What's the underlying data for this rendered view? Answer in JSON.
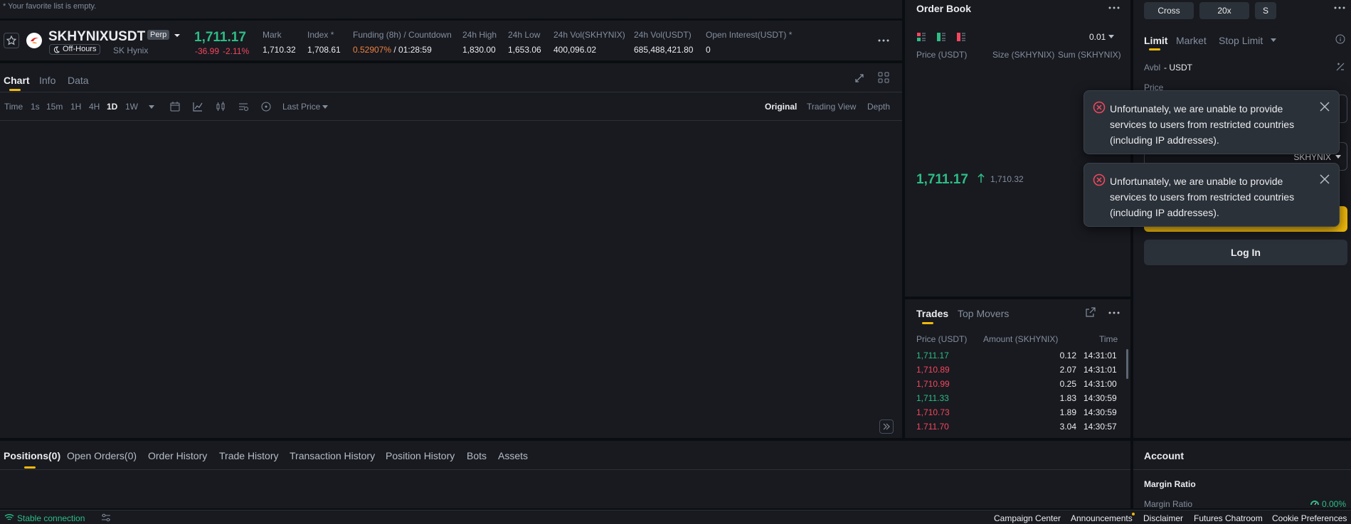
{
  "favorites": {
    "empty_text": "* Your favorite list is empty."
  },
  "ticker": {
    "symbol": "SKHYNIXUSDT",
    "contract_type": "Perp",
    "session_status": "Off-Hours",
    "name": "SK Hynix",
    "last_price": "1,711.17",
    "change_abs": "-36.99",
    "change_pct": "-2.11%",
    "fields": {
      "mark": {
        "label": "Mark",
        "value": "1,710.32"
      },
      "index": {
        "label": "Index *",
        "value": "1,708.61"
      },
      "funding": {
        "label": "Funding (8h) / Countdown",
        "rate": "0.52907%",
        "countdown": "/ 01:28:59"
      },
      "high": {
        "label": "24h High",
        "value": "1,830.00"
      },
      "low": {
        "label": "24h Low",
        "value": "1,653.06"
      },
      "vol_base": {
        "label": "24h Vol(SKHYNIX)",
        "value": "400,096.02"
      },
      "vol_quote": {
        "label": "24h Vol(USDT)",
        "value": "685,488,421.80"
      },
      "open_interest": {
        "label": "Open Interest(USDT) *",
        "value": "0"
      }
    }
  },
  "chart_tabs": [
    "Chart",
    "Info",
    "Data"
  ],
  "timeframes": [
    "Time",
    "1s",
    "15m",
    "1H",
    "4H",
    "1D",
    "1W"
  ],
  "active_timeframe": "1D",
  "price_type": "Last Price",
  "view_modes": [
    "Original",
    "Trading View",
    "Depth"
  ],
  "order_book": {
    "title": "Order Book",
    "tick_size": "0.01",
    "headers": [
      "Price (USDT)",
      "Size (SKHYNIX)",
      "Sum (SKHYNIX)"
    ],
    "last_price": "1,711.17",
    "mark_price": "1,710.32"
  },
  "trades": {
    "tabs": [
      "Trades",
      "Top Movers"
    ],
    "headers": [
      "Price (USDT)",
      "Amount (SKHYNIX)",
      "Time"
    ],
    "rows": [
      {
        "price": "1,711.17",
        "amount": "0.12",
        "time": "14:31:01",
        "side": "buy"
      },
      {
        "price": "1,710.89",
        "amount": "2.07",
        "time": "14:31:01",
        "side": "sell"
      },
      {
        "price": "1,710.99",
        "amount": "0.25",
        "time": "14:31:00",
        "side": "sell"
      },
      {
        "price": "1,711.33",
        "amount": "1.83",
        "time": "14:30:59",
        "side": "buy"
      },
      {
        "price": "1,710.73",
        "amount": "1.89",
        "time": "14:30:59",
        "side": "sell"
      },
      {
        "price": "1,711.70",
        "amount": "3.04",
        "time": "14:30:57",
        "side": "sell"
      }
    ]
  },
  "order_form": {
    "margin_mode": "Cross",
    "leverage": "20x",
    "asset_mode": "S",
    "order_types": [
      "Limit",
      "Market",
      "Stop Limit"
    ],
    "avbl_label": "Avbl",
    "avbl_value": "- USDT",
    "price_label": "Price",
    "size_unit": "SKHYNIX",
    "login_button": "Log In"
  },
  "toasts": [
    {
      "message": "Unfortunately, we are unable to provide services to users from restricted countries (including IP addresses)."
    },
    {
      "message": "Unfortunately, we are unable to provide services to users from restricted countries (including IP addresses)."
    }
  ],
  "bottom_tabs": [
    "Positions(0)",
    "Open Orders(0)",
    "Order History",
    "Trade History",
    "Transaction History",
    "Position History",
    "Bots",
    "Assets"
  ],
  "account": {
    "title": "Account",
    "margin_ratio_label": "Margin Ratio",
    "margin_ratio_row": "Margin Ratio",
    "margin_ratio_value": "0.00%"
  },
  "footer": {
    "connection": "Stable connection",
    "links": [
      "Campaign Center",
      "Announcements",
      "Disclaimer",
      "Futures Chatroom",
      "Cookie Preferences"
    ]
  },
  "colors": {
    "up": "#2ebd85",
    "down": "#f6465d",
    "accent": "#f0b90b",
    "bg": "#0b0e11",
    "panel": "#181a20"
  }
}
